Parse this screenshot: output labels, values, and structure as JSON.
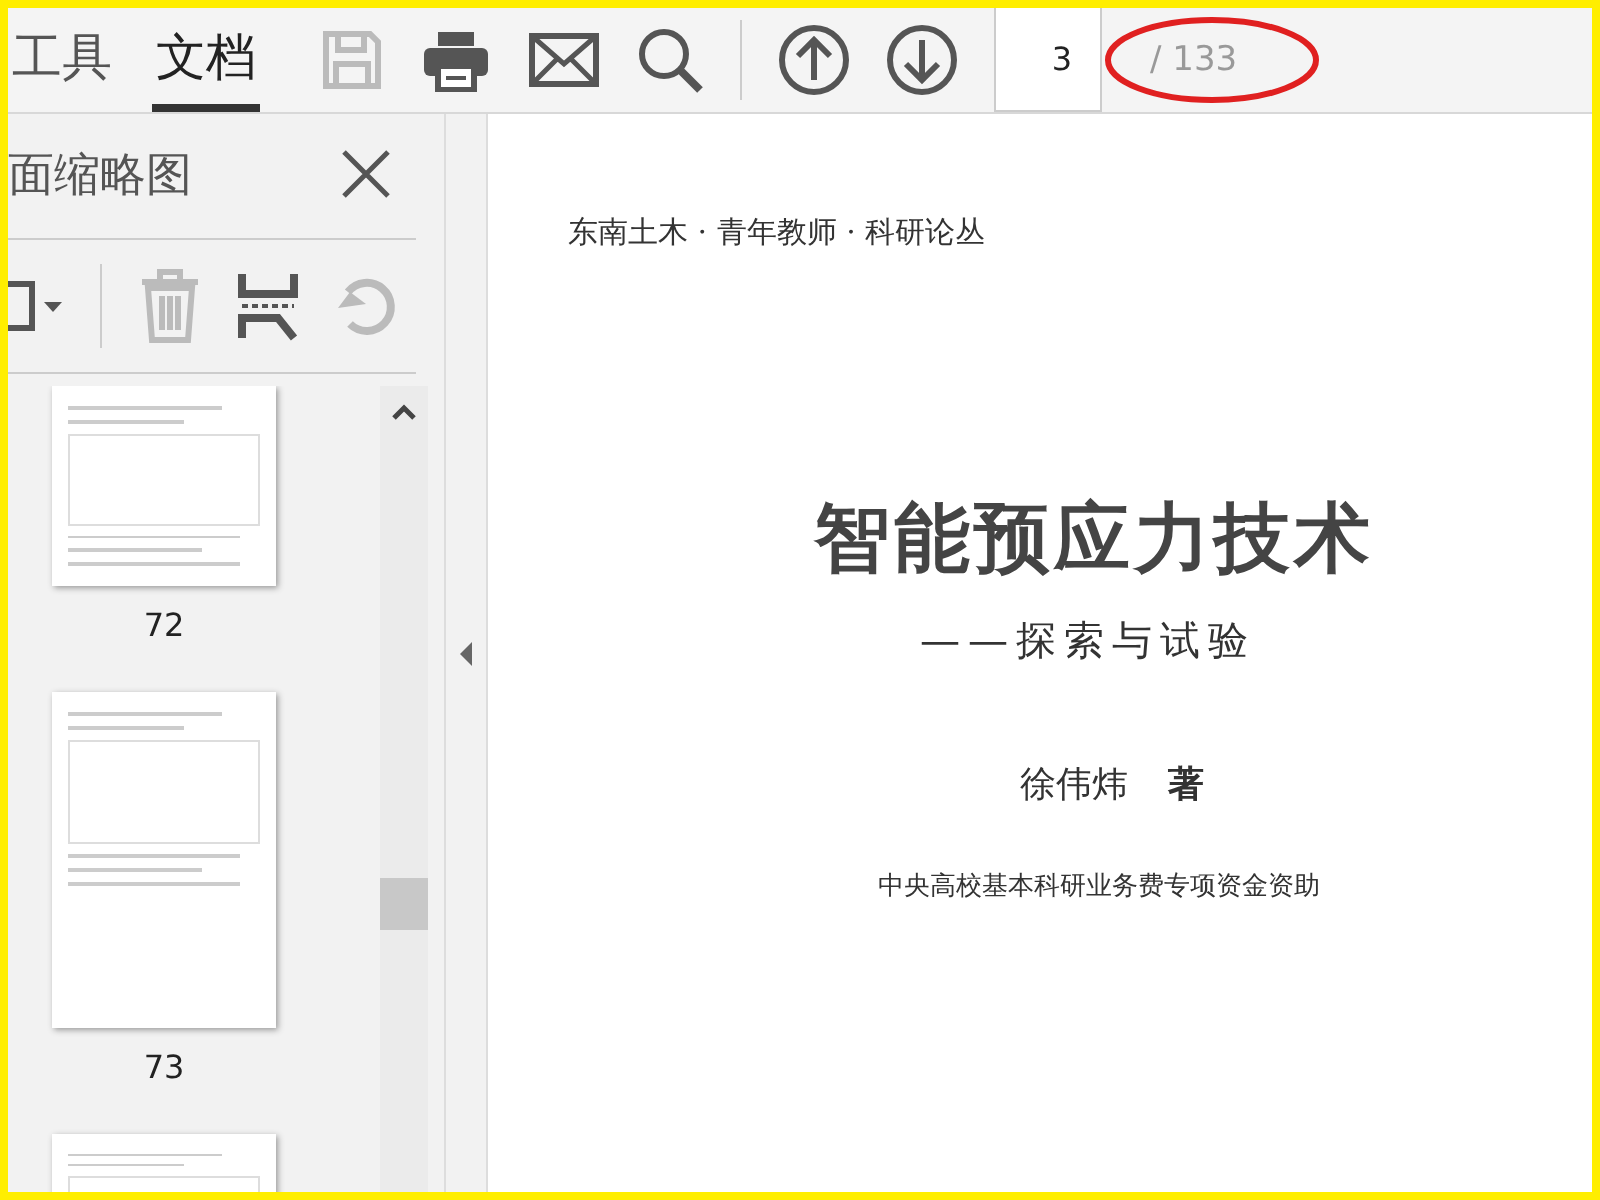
{
  "toolbar": {
    "tabs": [
      {
        "label": "工具",
        "selected": false
      },
      {
        "label": "文档",
        "selected": true
      }
    ],
    "buttons": [
      {
        "kind": "save",
        "disabled": true
      },
      {
        "kind": "print",
        "disabled": false
      },
      {
        "kind": "mail",
        "disabled": false
      },
      {
        "kind": "search",
        "disabled": false
      },
      {
        "kind": "prev",
        "disabled": false
      },
      {
        "kind": "next",
        "disabled": false
      }
    ],
    "page_number": "3",
    "page_total": "/ 133"
  },
  "sidebar": {
    "title": "面缩略图",
    "tools": [
      {
        "kind": "options",
        "disabled": false
      },
      {
        "kind": "delete",
        "disabled": true
      },
      {
        "kind": "extract",
        "disabled": false
      },
      {
        "kind": "rotate",
        "disabled": true
      }
    ],
    "thumbnails": [
      {
        "label": "72"
      },
      {
        "label": "73"
      },
      {
        "partial": true
      }
    ]
  },
  "document": {
    "series": "东南土木 · 青年教师 · 科研论丛",
    "title": "智能预应力技术",
    "subtitle": "——探索与试验",
    "author": "徐伟炜",
    "role": "著",
    "funding": "中央高校基本科研业务费专项资金资助"
  }
}
